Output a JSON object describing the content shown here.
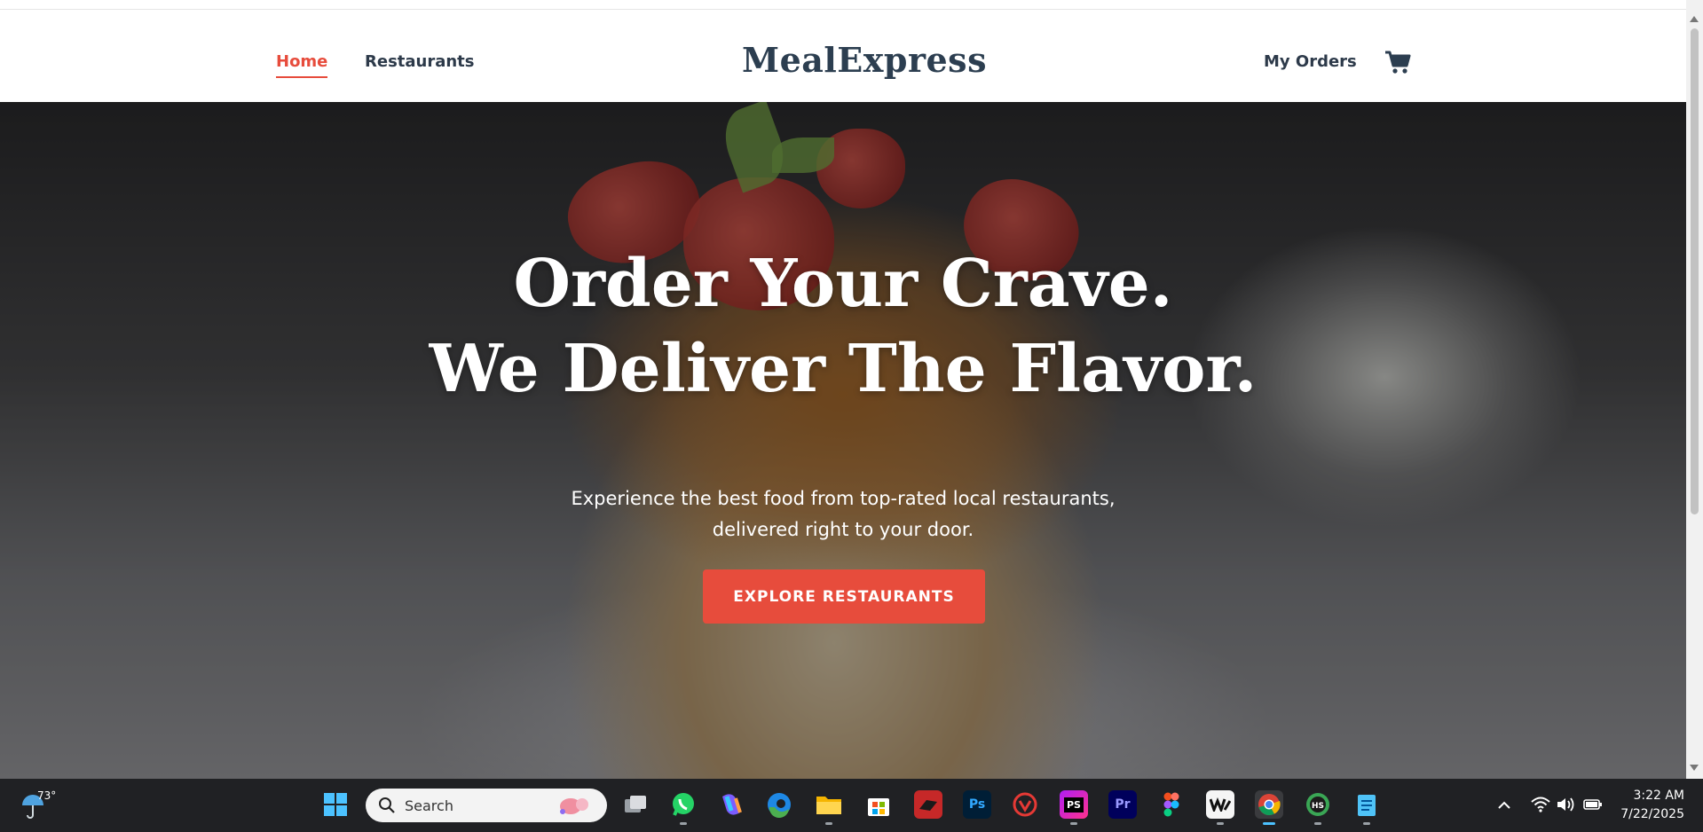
{
  "nav": {
    "home_label": "Home",
    "restaurants_label": "Restaurants",
    "brand": "MealExpress",
    "orders_label": "My Orders",
    "cart_icon": "cart-icon"
  },
  "hero": {
    "headline_line1": "Order Your Crave.",
    "headline_line2": "We Deliver The Flavor.",
    "subtitle_line1": "Experience the best food from top-rated local restaurants,",
    "subtitle_line2": "delivered right to your door.",
    "cta_label": "EXPLORE RESTAURANTS",
    "accent_color": "#e74c3c"
  },
  "taskbar": {
    "weather_temp": "73°",
    "search_placeholder": "Search",
    "clock_time": "3:22 AM",
    "clock_date": "7/22/2025",
    "pinned_apps": [
      "windows-start",
      "task-view",
      "whatsapp",
      "copilot",
      "edge",
      "file-explorer",
      "microsoft-store",
      "app-red",
      "photoshop",
      "app-game",
      "phpstorm",
      "premiere-pro",
      "figma",
      "app-wm",
      "chrome",
      "app-hs",
      "notepad"
    ]
  }
}
